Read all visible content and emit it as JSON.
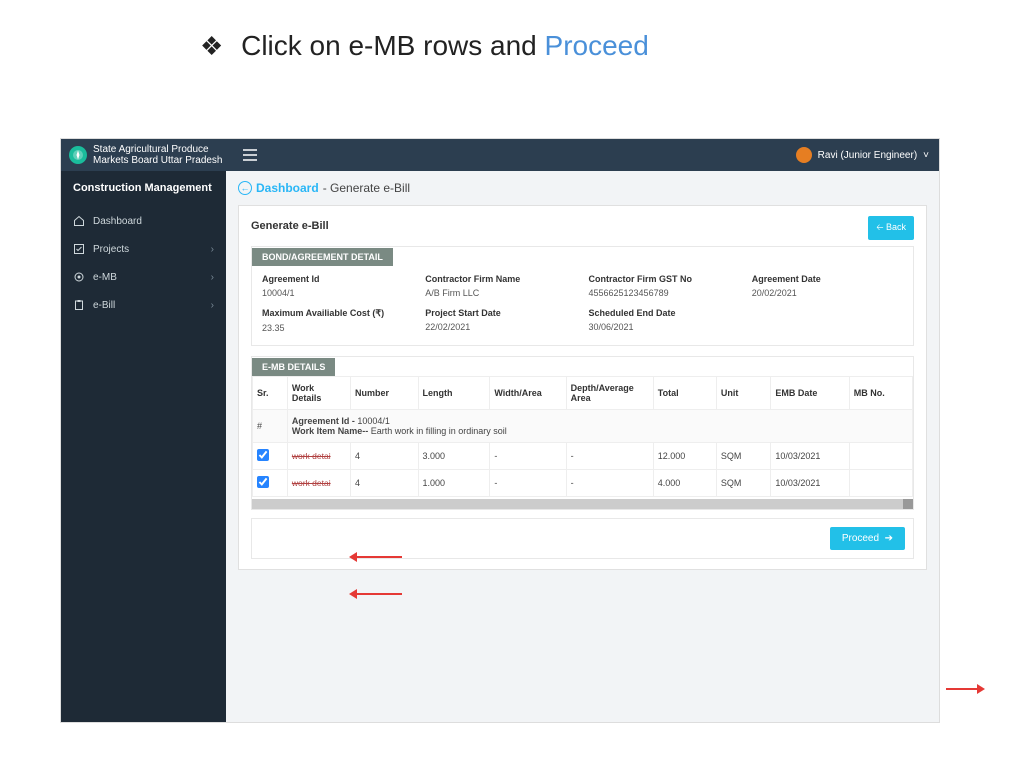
{
  "slide": {
    "prefix": "Click on e-MB rows and ",
    "highlight": "Proceed"
  },
  "org": {
    "line1": "State Agricultural Produce",
    "line2": "Markets Board Uttar Pradesh"
  },
  "user": {
    "name": "Ravi (Junior Engineer)"
  },
  "sidebar": {
    "title": "Construction Management",
    "items": [
      {
        "label": "Dashboard"
      },
      {
        "label": "Projects"
      },
      {
        "label": "e-MB"
      },
      {
        "label": "e-Bill"
      }
    ]
  },
  "breadcrumb": {
    "link": "Dashboard",
    "rest": " - Generate e-Bill"
  },
  "panel": {
    "title": "Generate e-Bill",
    "back": "Back"
  },
  "agreement_section": "BOND/AGREEMENT DETAIL",
  "agreement": [
    {
      "lab": "Agreement Id",
      "val": "10004/1"
    },
    {
      "lab": "Contractor Firm Name",
      "val": "A/B Firm LLC"
    },
    {
      "lab": "Contractor Firm GST No",
      "val": "4556625123456789"
    },
    {
      "lab": "Agreement Date",
      "val": "20/02/2021"
    },
    {
      "lab": "Maximum Availiable Cost (₹)",
      "val": "23.35"
    },
    {
      "lab": "Project Start Date",
      "val": "22/02/2021"
    },
    {
      "lab": "Scheduled End Date",
      "val": "30/06/2021"
    },
    {
      "lab": "",
      "val": ""
    }
  ],
  "emb_section": "E-MB DETAILS",
  "emb_headers": [
    "Sr.",
    "Work Details",
    "Number",
    "Length",
    "Width/Area",
    "Depth/Average Area",
    "Total",
    "Unit",
    "EMB Date",
    "MB No."
  ],
  "emb_group": {
    "hash": "#",
    "agr_label": "Agreement Id - ",
    "agr_val": "10004/1",
    "item_label": "Work Item Name-- ",
    "item_val": "Earth work in filling in ordinary soil"
  },
  "emb_rows": [
    {
      "work": "work detai",
      "number": "4",
      "length": "3.000",
      "width": "-",
      "depth": "-",
      "total": "12.000",
      "unit": "SQM",
      "date": "10/03/2021",
      "mb": ""
    },
    {
      "work": "work detai",
      "number": "4",
      "length": "1.000",
      "width": "-",
      "depth": "-",
      "total": "4.000",
      "unit": "SQM",
      "date": "10/03/2021",
      "mb": ""
    }
  ],
  "proceed": "Proceed"
}
